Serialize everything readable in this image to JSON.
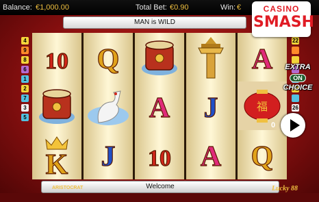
{
  "topbar": {
    "balance_label": "Balance:",
    "balance_value": "€1,000.00",
    "total_bet_label": "Total Bet:",
    "total_bet_value": "€0.90",
    "win_label": "Win:",
    "win_value": "€"
  },
  "logo": {
    "line1": "CASINO",
    "line2": "SMASH"
  },
  "banner": {
    "text": "MAN is WILD"
  },
  "paylines": {
    "left": [
      "4",
      "9",
      "8",
      "6",
      "1",
      "2",
      "7",
      "3",
      "5"
    ],
    "right": [
      "22",
      "",
      "",
      "",
      "",
      "",
      "",
      "26",
      "25"
    ],
    "colors": [
      "#f3d43a",
      "#ff8a2a",
      "#f3d43a",
      "#b56bd1",
      "#53c0e0",
      "#f3d43a",
      "#53c0e0",
      "#f0f0f0",
      "#53c0e0"
    ]
  },
  "reels": [
    [
      "10",
      "drum",
      "K"
    ],
    [
      "Q",
      "crane",
      "J"
    ],
    [
      "drum",
      "A",
      "10"
    ],
    [
      "pagoda",
      "J",
      "A"
    ],
    [
      "A",
      "lantern",
      "Q"
    ]
  ],
  "extra_choice": {
    "line1": "EXTRA",
    "on": "ON",
    "line2": "CHOICE"
  },
  "play_button": {
    "icon": "play-icon"
  },
  "welcome": {
    "text": "Welcome"
  },
  "brand_left": "ARISTOCRAT",
  "brand_right": "Lucky 88",
  "side_number": "0"
}
